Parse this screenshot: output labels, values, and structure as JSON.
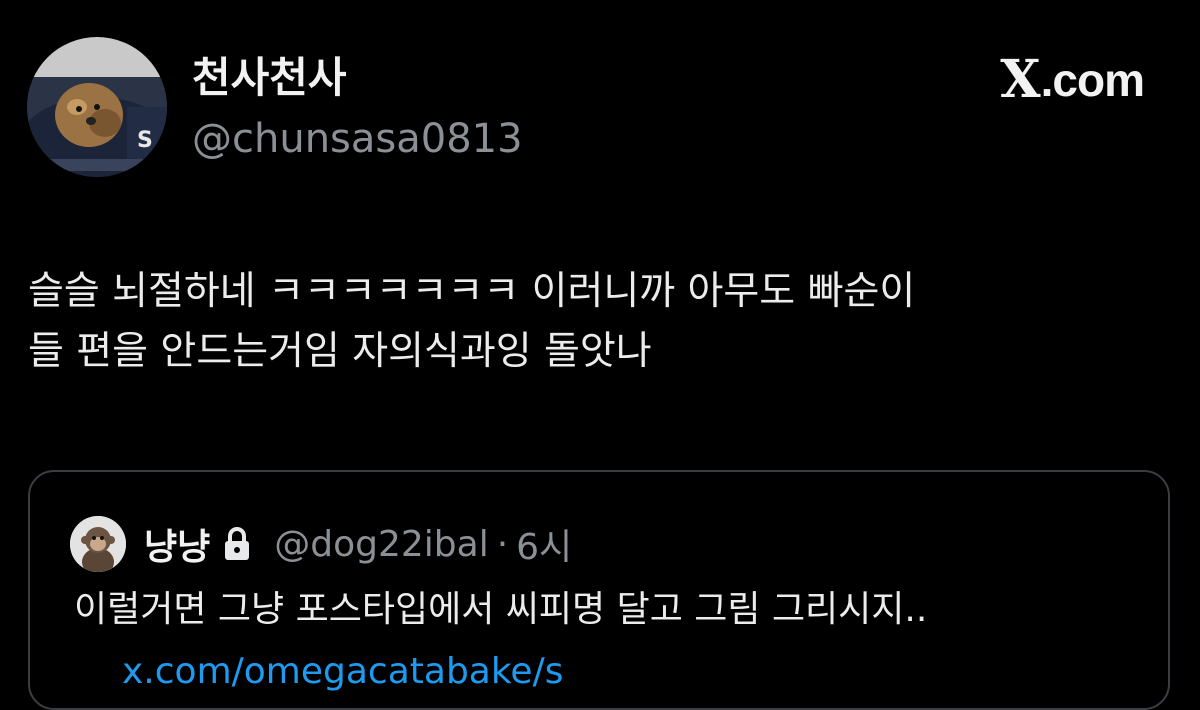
{
  "tweet": {
    "display_name": "천사천사",
    "handle": "@chunsasa0813",
    "brand": {
      "x": "X",
      "suffix": ".com"
    },
    "avatar_icon": "dog-avatar-icon",
    "text_lines": [
      "슬슬 뇌절하네 ㅋㅋㅋㅋㅋㅋㅋ 이러니까 아무도 빠순이",
      "들 편을 안드는거임 자의식과잉 돌앗나"
    ],
    "quote": {
      "avatar_icon": "monkey-avatar-icon",
      "display_name": "냥냥",
      "lock_icon": "lock-icon",
      "handle": "@dog22ibal",
      "separator": "·",
      "time": "6시",
      "text": "이럴거면 그냥 포스타입에서 씨피명 달고 그림 그리시지..",
      "link": "x.com/omegacatabake/s"
    }
  },
  "colors": {
    "background": "#000000",
    "primary_text": "#e7e9ea",
    "secondary_text": "#8b9096",
    "link": "#1d9bf0",
    "border": "#3a3d42"
  }
}
